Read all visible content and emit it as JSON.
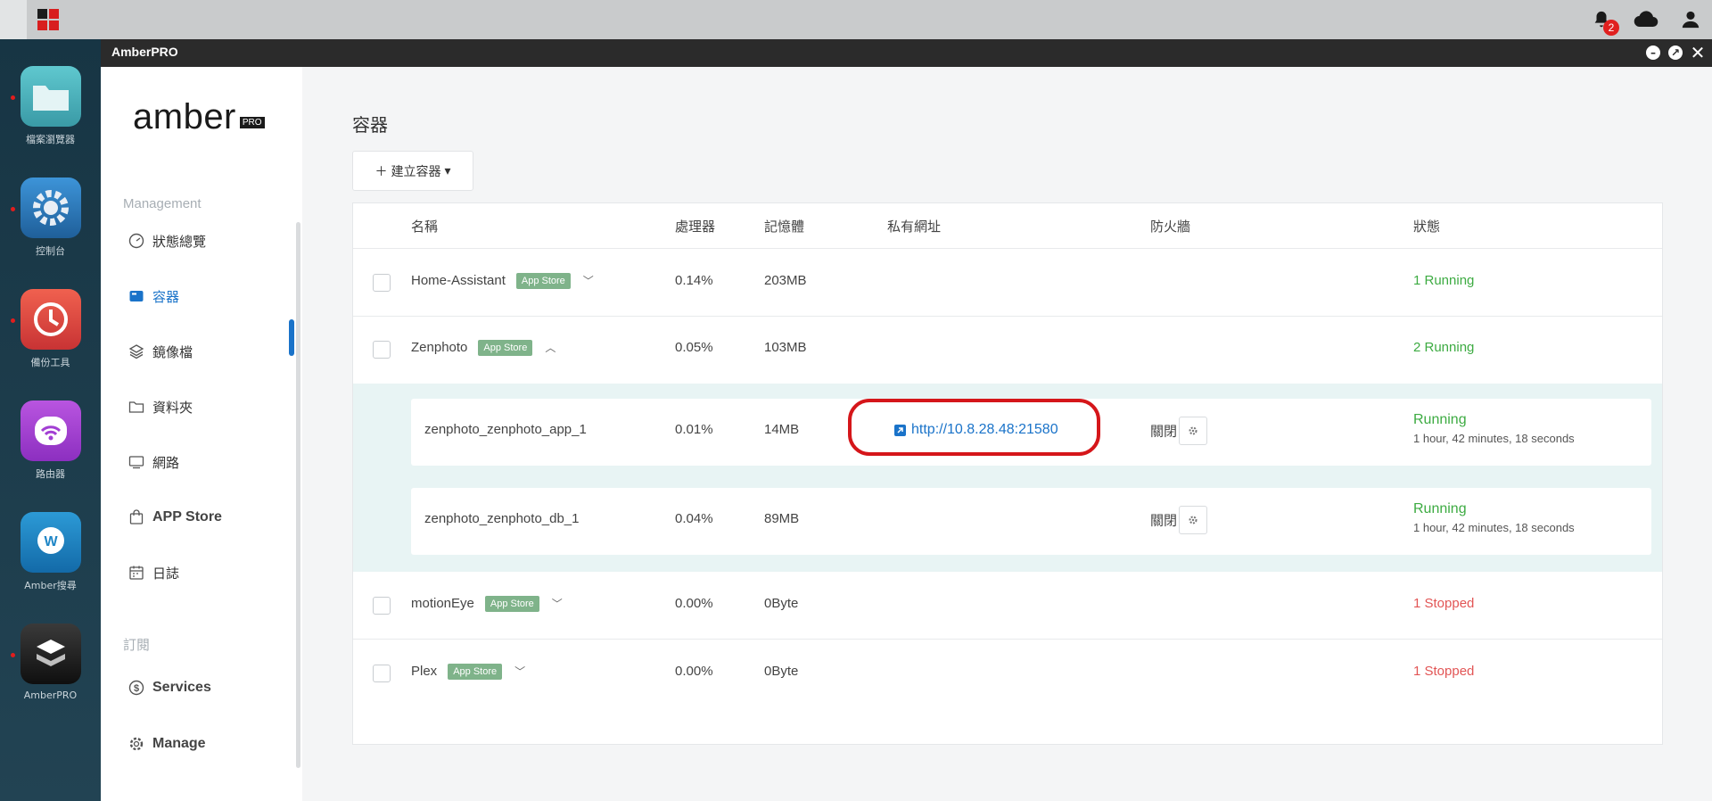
{
  "topbar": {
    "notification_count": "2"
  },
  "dock": {
    "items": [
      {
        "label": "檔案瀏覽器",
        "color": "#4fb7c2"
      },
      {
        "label": "控制台",
        "color": "#2e7cc4"
      },
      {
        "label": "備份工具",
        "color": "#e4463f"
      },
      {
        "label": "路由器",
        "color": "#a23fd3"
      },
      {
        "label": "Amber搜尋",
        "color": "#1f86c6"
      },
      {
        "label": "AmberPRO",
        "color": "#1f1f1f"
      }
    ]
  },
  "window": {
    "title": "AmberPRO"
  },
  "sidebar": {
    "logo": "amber",
    "logo_badge": "PRO",
    "management_heading": "Management",
    "items": [
      {
        "label": "狀態總覽",
        "icon": "dashboard-icon"
      },
      {
        "label": "容器",
        "icon": "container-icon"
      },
      {
        "label": "鏡像檔",
        "icon": "layers-icon"
      },
      {
        "label": "資料夾",
        "icon": "folder-icon"
      },
      {
        "label": "網路",
        "icon": "monitor-icon"
      },
      {
        "label": "APP Store",
        "icon": "bag-icon"
      },
      {
        "label": "日誌",
        "icon": "calendar-icon"
      }
    ],
    "subscribe_heading": "訂閱",
    "sub_items": [
      {
        "label": "Services",
        "icon": "dollar-icon"
      },
      {
        "label": "Manage",
        "icon": "gear-icon"
      }
    ]
  },
  "main": {
    "page_title": "容器",
    "create_button": "建立容器",
    "columns": [
      "名稱",
      "處理器",
      "記憶體",
      "私有網址",
      "防火牆",
      "狀態"
    ],
    "rows": [
      {
        "name": "Home-Assistant",
        "tag": "App Store",
        "cpu": "0.14%",
        "mem": "203MB",
        "status": "1 Running"
      },
      {
        "name": "Zenphoto",
        "tag": "App Store",
        "cpu": "0.05%",
        "mem": "103MB",
        "status": "2 Running"
      },
      {
        "name": "motionEye",
        "tag": "App Store",
        "cpu": "0.00%",
        "mem": "0Byte",
        "status": "1 Stopped"
      },
      {
        "name": "Plex",
        "tag": "App Store",
        "cpu": "0.00%",
        "mem": "0Byte",
        "status": "1 Stopped"
      }
    ],
    "sub_rows": [
      {
        "name": "zenphoto_zenphoto_app_1",
        "cpu": "0.01%",
        "mem": "14MB",
        "url": "http://10.8.28.48:21580",
        "firewall": "關閉",
        "status": "Running",
        "uptime": "1 hour, 42 minutes, 18 seconds"
      },
      {
        "name": "zenphoto_zenphoto_db_1",
        "cpu": "0.04%",
        "mem": "89MB",
        "url": "",
        "firewall": "關閉",
        "status": "Running",
        "uptime": "1 hour, 42 minutes, 18 seconds"
      }
    ]
  },
  "colors": {
    "accent": "#1a73c9",
    "running": "#3dab42",
    "stopped": "#e25555",
    "tag": "#7fb38a",
    "highlight": "#d5161a"
  }
}
